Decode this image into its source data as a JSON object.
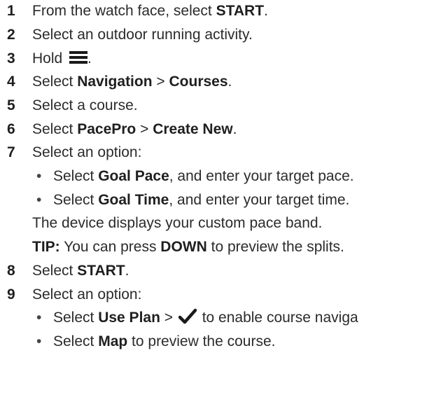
{
  "steps": {
    "s1": {
      "num": "1",
      "pre": "From the watch face, select ",
      "bold1": "START",
      "post": "."
    },
    "s2": {
      "num": "2",
      "text": "Select an outdoor running activity."
    },
    "s3": {
      "num": "3",
      "pre": "Hold ",
      "icon": "menu-icon",
      "post": "."
    },
    "s4": {
      "num": "4",
      "pre": "Select ",
      "bold1": "Navigation",
      "mid": " > ",
      "bold2": "Courses",
      "post": "."
    },
    "s5": {
      "num": "5",
      "text": "Select a course."
    },
    "s6": {
      "num": "6",
      "pre": "Select ",
      "bold1": "PacePro",
      "mid": " > ",
      "bold2": "Create New",
      "post": "."
    },
    "s7": {
      "num": "7",
      "text": "Select an option:"
    },
    "s7a": {
      "bullet": "•",
      "pre": "Select ",
      "bold1": "Goal Pace",
      "post": ", and enter your target pace."
    },
    "s7b": {
      "bullet": "•",
      "pre": "Select ",
      "bold1": "Goal Time",
      "post": ", and enter your target time."
    },
    "s7c": {
      "text": "The device displays your custom pace band."
    },
    "s7d": {
      "bold1": "TIP:",
      "pre": " You can press ",
      "bold2": "DOWN",
      "post": " to preview the splits."
    },
    "s8": {
      "num": "8",
      "pre": "Select ",
      "bold1": "START",
      "post": "."
    },
    "s9": {
      "num": "9",
      "text": "Select an option:"
    },
    "s9a": {
      "bullet": "•",
      "pre": "Select ",
      "bold1": "Use Plan",
      "mid": " > ",
      "icon": "checkmark-icon",
      "post": " to enable course naviga"
    },
    "s9b": {
      "bullet": "•",
      "pre": "Select ",
      "bold1": "Map",
      "post": " to preview the course."
    }
  }
}
